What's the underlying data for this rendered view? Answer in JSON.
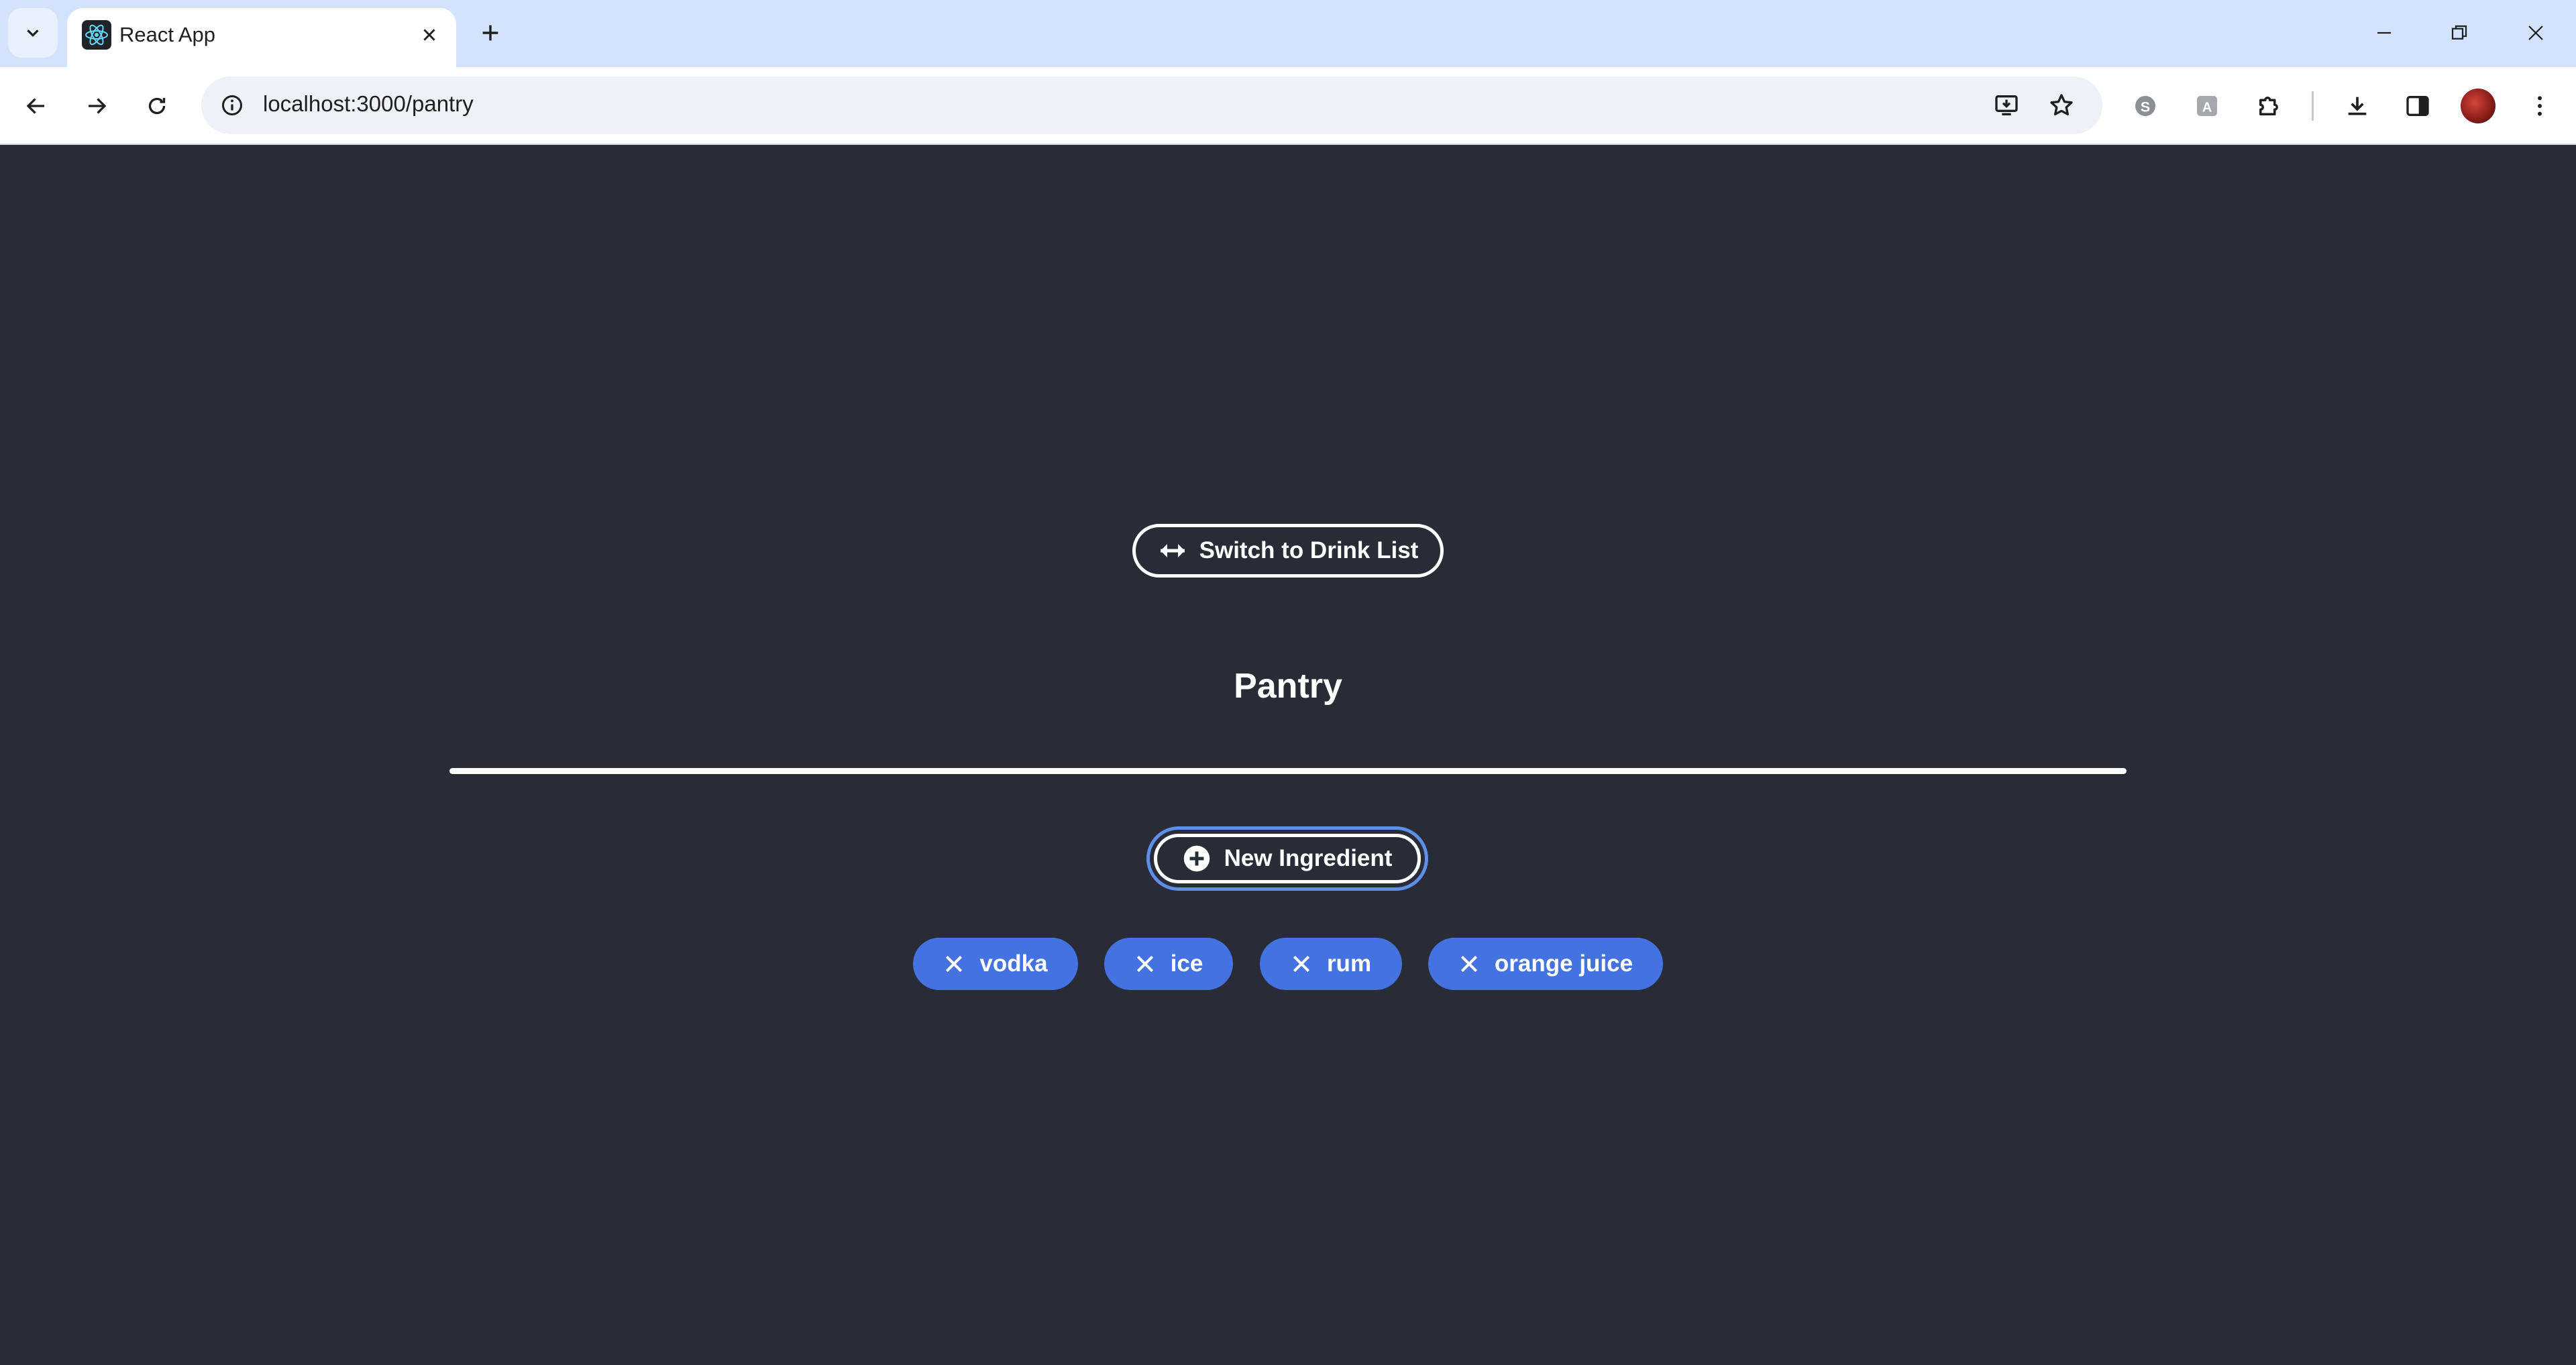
{
  "browser": {
    "tab_title": "React App",
    "url": "localhost:3000/pantry",
    "icons": {
      "tab_search": "chevron-down-icon",
      "favicon": "react-icon",
      "tab_close": "close-icon",
      "new_tab": "plus-icon",
      "back": "arrow-left-icon",
      "forward": "arrow-right-icon",
      "reload": "reload-icon",
      "site_info": "info-icon",
      "install": "install-app-icon",
      "bookmark": "star-icon",
      "skype": "skype-icon",
      "translate": "translate-icon",
      "extensions": "puzzle-icon",
      "downloads": "download-icon",
      "side_panel": "side-panel-icon",
      "menu": "kebab-menu-icon"
    }
  },
  "page": {
    "switch_button_label": "Switch to Drink List",
    "title": "Pantry",
    "new_ingredient_label": "New Ingredient",
    "ingredients": [
      "vodka",
      "ice",
      "rum",
      "orange juice"
    ]
  },
  "colors": {
    "background": "#282c37",
    "chip": "#4472e0",
    "focus_ring": "#5f8fe6",
    "tabstrip": "#d3e3fd"
  }
}
